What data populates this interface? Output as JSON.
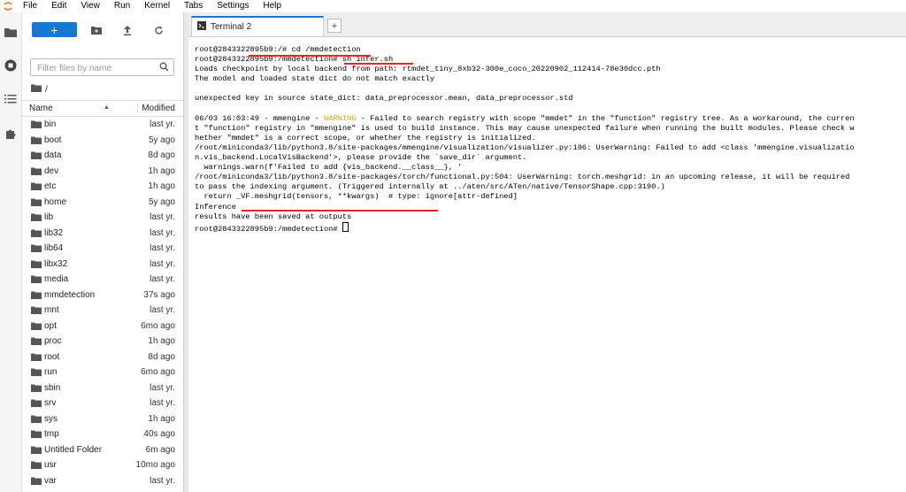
{
  "menubar": {
    "items": [
      "File",
      "Edit",
      "View",
      "Run",
      "Kernel",
      "Tabs",
      "Settings",
      "Help"
    ]
  },
  "sidebar_icons": [
    "folder-icon",
    "running-icon",
    "toc-icon",
    "extension-icon"
  ],
  "filebrowser": {
    "new_label": "+",
    "filter_placeholder": "Filter files by name",
    "breadcrumb": "/",
    "col_name": "Name",
    "col_modified": "Modified",
    "rows": [
      {
        "name": "bin",
        "modified": "last yr."
      },
      {
        "name": "boot",
        "modified": "5y ago"
      },
      {
        "name": "data",
        "modified": "8d ago"
      },
      {
        "name": "dev",
        "modified": "1h ago"
      },
      {
        "name": "etc",
        "modified": "1h ago"
      },
      {
        "name": "home",
        "modified": "5y ago"
      },
      {
        "name": "lib",
        "modified": "last yr."
      },
      {
        "name": "lib32",
        "modified": "last yr."
      },
      {
        "name": "lib64",
        "modified": "last yr."
      },
      {
        "name": "libx32",
        "modified": "last yr."
      },
      {
        "name": "media",
        "modified": "last yr."
      },
      {
        "name": "mmdetection",
        "modified": "37s ago"
      },
      {
        "name": "mnt",
        "modified": "last yr."
      },
      {
        "name": "opt",
        "modified": "6mo ago"
      },
      {
        "name": "proc",
        "modified": "1h ago"
      },
      {
        "name": "root",
        "modified": "8d ago"
      },
      {
        "name": "run",
        "modified": "6mo ago"
      },
      {
        "name": "sbin",
        "modified": "last yr."
      },
      {
        "name": "srv",
        "modified": "last yr."
      },
      {
        "name": "sys",
        "modified": "1h ago"
      },
      {
        "name": "tmp",
        "modified": "40s ago"
      },
      {
        "name": "Untitled Folder",
        "modified": "6m ago"
      },
      {
        "name": "usr",
        "modified": "10mo ago"
      },
      {
        "name": "var",
        "modified": "last yr."
      }
    ]
  },
  "tab": {
    "title": "Terminal 2",
    "add_label": "+"
  },
  "terminal": {
    "warning_color": "#e3a21a",
    "underline_color": "#e8242a",
    "line1": "root@2843322895b9:/# cd /mmdetection",
    "line2": "root@2843322895b9:/mmdetection# sh infer.sh",
    "line3": "Loads checkpoint by local backend from path: rtmdet_tiny_8xb32-300e_coco_20220902_112414-78e30dcc.pth",
    "line4": "The model and loaded state dict do not match exactly",
    "line5": "",
    "line6": "unexpected key in source state_dict: data_preprocessor.mean, data_preprocessor.std",
    "line7": "",
    "line8_pre": "06/03 16:03:49 - mmengine - ",
    "line8_warn": "WARNING",
    "line8_post": " - Failed to search registry with scope \"mmdet\" in the \"function\" registry tree. As a workaround, the curren",
    "line9": "t \"function\" registry in \"mmengine\" is used to build instance. This may cause unexpected failure when running the built modules. Please check w",
    "line10": "hether \"mmdet\" is a correct scope, or whether the registry is initialized.",
    "line11": "/root/miniconda3/lib/python3.8/site-packages/mmengine/visualization/visualizer.py:196: UserWarning: Failed to add <class 'mmengine.visualizatio",
    "line12": "n.vis_backend.LocalVisBackend'>, please provide the `save_dir` argument.",
    "line13": "  warnings.warn(f'Failed to add {vis_backend.__class__}, '",
    "line14": "/root/miniconda3/lib/python3.8/site-packages/torch/functional.py:504: UserWarning: torch.meshgrid: in an upcoming release, it will be required",
    "line15": "to pass the indexing argument. (Triggered internally at ../aten/src/ATen/native/TensorShape.cpp:3190.)",
    "line16": "  return _VF.meshgrid(tensors, **kwargs)  # type: ignore[attr-defined]",
    "line17": "Inference ",
    "line18": "results have been saved at outputs",
    "line19": "root@2843322895b9:/mmdetection# "
  }
}
